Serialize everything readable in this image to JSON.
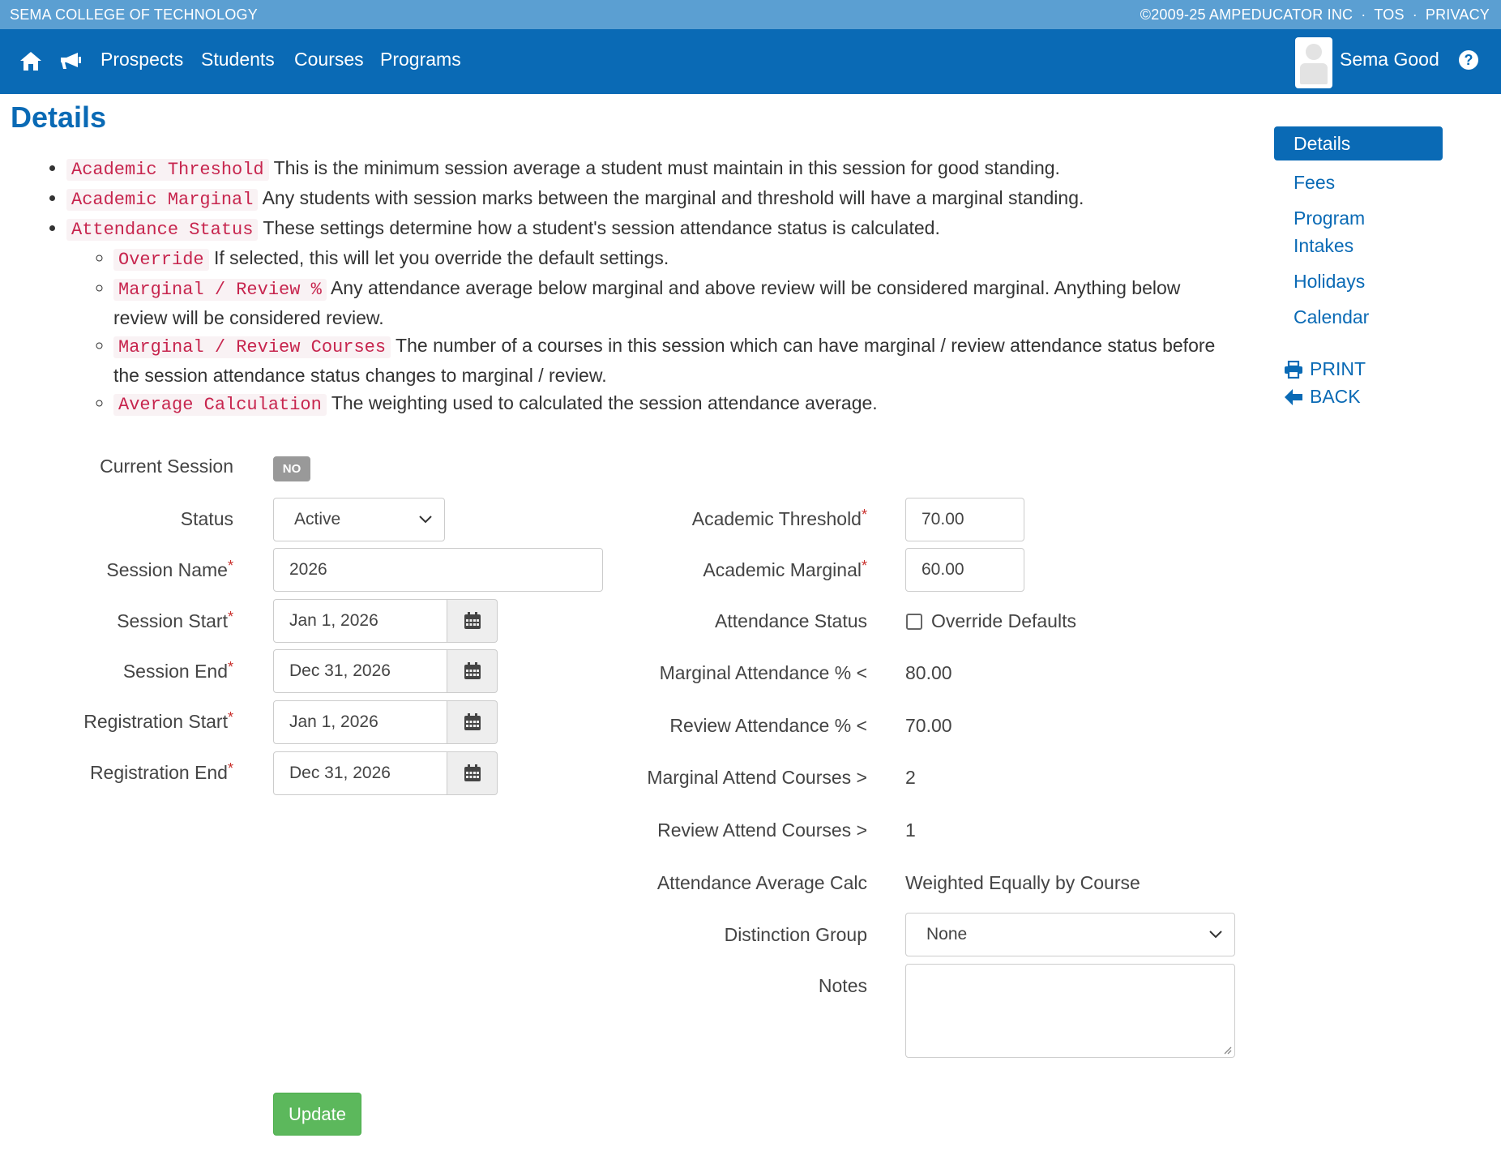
{
  "topbar": {
    "school_name": "SEMA COLLEGE OF TECHNOLOGY",
    "copyright": "©2009-25 AMPEDUCATOR INC",
    "tos": "TOS",
    "privacy": "PRIVACY",
    "separator": "·"
  },
  "navbar": {
    "icons": [
      "home-icon",
      "megaphone-icon"
    ],
    "links": [
      "Prospects",
      "Students",
      "Courses",
      "Programs"
    ],
    "user_name": "Sema Good",
    "help_icon": "?"
  },
  "page": {
    "title": "Details"
  },
  "help": {
    "items": [
      {
        "term": "Academic Threshold",
        "text": "This is the minimum session average a student must maintain in this session for good standing."
      },
      {
        "term": "Academic Marginal",
        "text": "Any students with session marks between the marginal and threshold will have a marginal standing."
      },
      {
        "term": "Attendance Status",
        "text": "These settings determine how a student's session attendance status is calculated."
      }
    ],
    "sub_items": [
      {
        "term": "Override",
        "text": "If selected, this will let you override the default settings."
      },
      {
        "term": "Marginal / Review %",
        "text": "Any attendance average below marginal and above review will be considered marginal. Anything below review will be considered review."
      },
      {
        "term": "Marginal / Review Courses",
        "text": "The number of a courses in this session which can have marginal / review attendance status before the session attendance status changes to marginal / review."
      },
      {
        "term": "Average Calculation",
        "text": "The weighting used to calculated the session attendance average."
      }
    ]
  },
  "sidebar": {
    "items": [
      "Details",
      "Fees",
      "Program Intakes",
      "Holidays",
      "Calendar"
    ],
    "active": "Details",
    "print": "PRINT",
    "back": "BACK"
  },
  "form": {
    "current_session": {
      "label": "Current Session",
      "value": "NO"
    },
    "status": {
      "label": "Status",
      "value": "Active"
    },
    "session_name": {
      "label": "Session Name",
      "value": "2026"
    },
    "session_start": {
      "label": "Session Start",
      "value": "Jan 1, 2026"
    },
    "session_end": {
      "label": "Session End",
      "value": "Dec 31, 2026"
    },
    "registration_start": {
      "label": "Registration Start",
      "value": "Jan 1, 2026"
    },
    "registration_end": {
      "label": "Registration End",
      "value": "Dec 31, 2026"
    },
    "academic_threshold": {
      "label": "Academic Threshold",
      "value": "70.00"
    },
    "academic_marginal": {
      "label": "Academic Marginal",
      "value": "60.00"
    },
    "attendance_status": {
      "label": "Attendance Status",
      "checkbox_label": "Override Defaults",
      "checked": false
    },
    "marginal_attendance": {
      "label": "Marginal Attendance % <",
      "value": "80.00"
    },
    "review_attendance": {
      "label": "Review Attendance % <",
      "value": "70.00"
    },
    "marginal_attend_courses": {
      "label": "Marginal Attend Courses >",
      "value": "2"
    },
    "review_attend_courses": {
      "label": "Review Attend Courses >",
      "value": "1"
    },
    "attendance_average_calc": {
      "label": "Attendance Average Calc",
      "value": "Weighted Equally by Course"
    },
    "distinction_group": {
      "label": "Distinction Group",
      "value": "None"
    },
    "notes": {
      "label": "Notes",
      "value": ""
    },
    "required_marker": "*",
    "update_button": "Update"
  },
  "colors": {
    "topstrip": "#5b9fd2",
    "navbar": "#0a6ab5",
    "accent": "#0a6ab5",
    "code_text": "#c7254e",
    "success": "#5cb85c",
    "required": "#c9302c"
  }
}
